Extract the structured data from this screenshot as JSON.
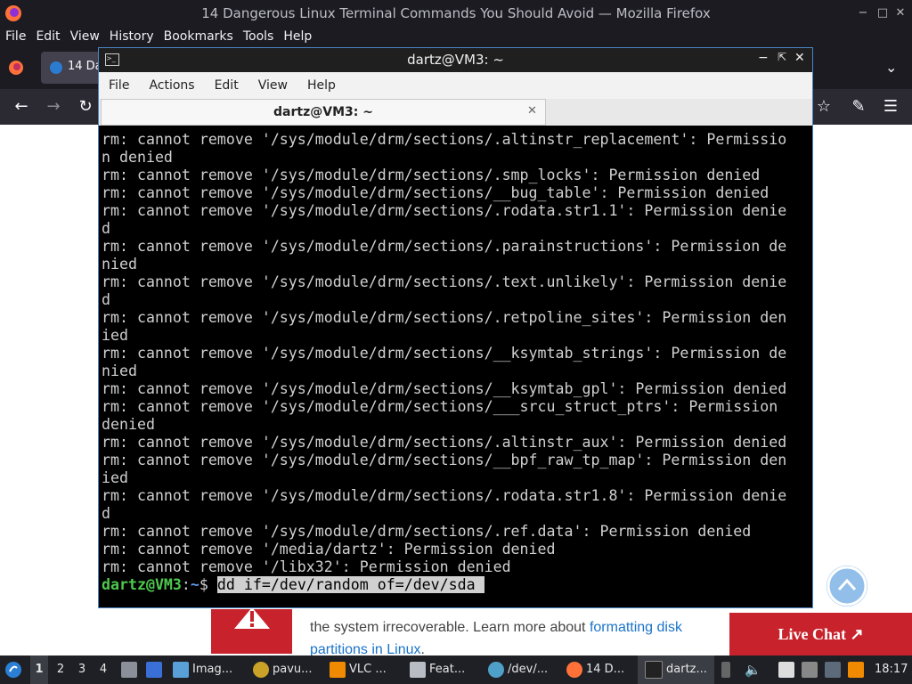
{
  "firefox": {
    "window_title": "14 Dangerous Linux Terminal Commands You Should Avoid — Mozilla Firefox",
    "menu": [
      "File",
      "Edit",
      "View",
      "History",
      "Bookmarks",
      "Tools",
      "Help"
    ],
    "tab_label": "14 Da"
  },
  "article": {
    "top_line": "...",
    "line1": "the system irrecoverable. Learn more about ",
    "link1": "formatting disk",
    "link2": "partitions in Linux",
    "line2_end": "."
  },
  "live_chat": {
    "label": "Live Chat ↗"
  },
  "terminal": {
    "title": "dartz@VM3: ~",
    "menu": [
      "File",
      "Actions",
      "Edit",
      "View",
      "Help"
    ],
    "tab_label": "dartz@VM3: ~",
    "lines": [
      "rm: cannot remove '/sys/module/drm/sections/.altinstr_replacement': Permissio",
      "n denied",
      "rm: cannot remove '/sys/module/drm/sections/.smp_locks': Permission denied",
      "rm: cannot remove '/sys/module/drm/sections/__bug_table': Permission denied",
      "rm: cannot remove '/sys/module/drm/sections/.rodata.str1.1': Permission denie",
      "d",
      "rm: cannot remove '/sys/module/drm/sections/.parainstructions': Permission de",
      "nied",
      "rm: cannot remove '/sys/module/drm/sections/.text.unlikely': Permission denie",
      "d",
      "rm: cannot remove '/sys/module/drm/sections/.retpoline_sites': Permission den",
      "ied",
      "rm: cannot remove '/sys/module/drm/sections/__ksymtab_strings': Permission de",
      "nied",
      "rm: cannot remove '/sys/module/drm/sections/__ksymtab_gpl': Permission denied",
      "rm: cannot remove '/sys/module/drm/sections/___srcu_struct_ptrs': Permission",
      "denied",
      "rm: cannot remove '/sys/module/drm/sections/.altinstr_aux': Permission denied",
      "rm: cannot remove '/sys/module/drm/sections/__bpf_raw_tp_map': Permission den",
      "ied",
      "rm: cannot remove '/sys/module/drm/sections/.rodata.str1.8': Permission denie",
      "d",
      "rm: cannot remove '/sys/module/drm/sections/.ref.data': Permission denied",
      "rm: cannot remove '/media/dartz': Permission denied",
      "rm: cannot remove '/libx32': Permission denied"
    ],
    "prompt_user": "dartz@VM3",
    "prompt_sep": ":",
    "prompt_path": "~",
    "prompt_dollar": "$ ",
    "command": "dd if=/dev/random of=/dev/sda "
  },
  "taskbar": {
    "workspaces": [
      "1",
      "2",
      "3",
      "4"
    ],
    "items": [
      {
        "label": "Imag...",
        "icon": "image-viewer-icon"
      },
      {
        "label": "pavu...",
        "icon": "pavucontrol-icon"
      },
      {
        "label": "VLC ...",
        "icon": "vlc-icon"
      },
      {
        "label": "Feat...",
        "icon": "clipboard-icon"
      },
      {
        "label": "/dev/...",
        "icon": "file-manager-icon"
      },
      {
        "label": "14 D...",
        "icon": "firefox-icon"
      },
      {
        "label": "dartz...",
        "icon": "terminal-icon"
      }
    ],
    "clock": "18:17"
  }
}
